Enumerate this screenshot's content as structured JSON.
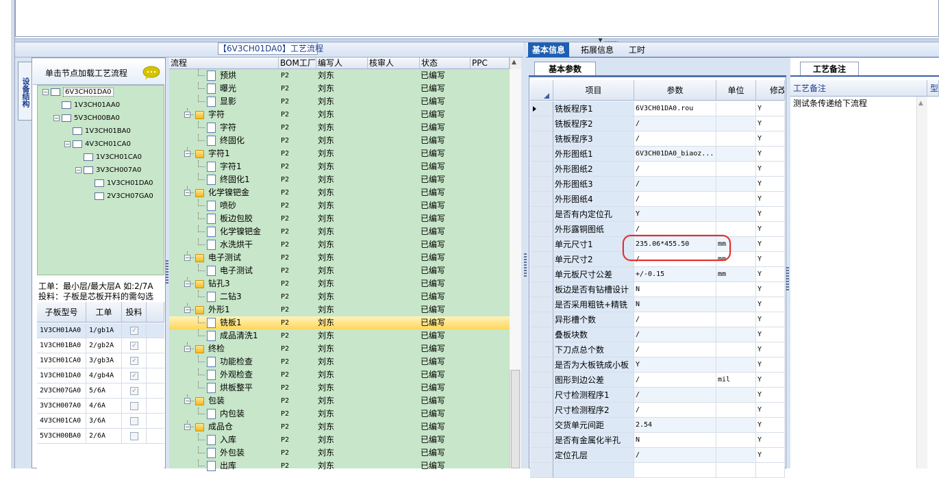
{
  "window": {
    "flow_title": "【6V3CH01DA0】工艺流程",
    "vertical_tab": "设备结构"
  },
  "tree_panel": {
    "load_hint": "单击节点加载工艺流程",
    "nodes": [
      {
        "label": "6V3CH01DA0",
        "selected": true
      },
      {
        "label": "1V3CH01AA0"
      },
      {
        "label": "5V3CH00BA0"
      },
      {
        "label": "1V3CH01BA0"
      },
      {
        "label": "4V3CH01CA0"
      },
      {
        "label": "1V3CH01CA0"
      },
      {
        "label": "3V3CH007A0"
      },
      {
        "label": "1V3CH01DA0"
      },
      {
        "label": "2V3CH07GA0"
      }
    ],
    "info_line1": "工单：最小层/最大层A 如:2/7A",
    "info_line2": "投料：子板是芯板开料的需勾选"
  },
  "board_grid": {
    "headers": [
      "子板型号",
      "工单",
      "投料"
    ],
    "rows": [
      {
        "model": "1V3CH01AA0",
        "order": "1/gb1A",
        "feed": true
      },
      {
        "model": "1V3CH01BA0",
        "order": "2/gb2A",
        "feed": true
      },
      {
        "model": "1V3CH01CA0",
        "order": "3/gb3A",
        "feed": true
      },
      {
        "model": "1V3CH01DA0",
        "order": "4/gb4A",
        "feed": true
      },
      {
        "model": "2V3CH07GA0",
        "order": "5/6A",
        "feed": true
      },
      {
        "model": "3V3CH007A0",
        "order": "4/6A",
        "feed": false
      },
      {
        "model": "4V3CH01CA0",
        "order": "3/6A",
        "feed": false
      },
      {
        "model": "5V3CH00BA0",
        "order": "2/6A",
        "feed": false
      }
    ]
  },
  "flow_grid": {
    "headers": [
      "流程",
      "BOM工厂",
      "编写人",
      "核审人",
      "状态",
      "PPC"
    ],
    "rows": [
      {
        "name": "预烘",
        "kind": "child",
        "bom": "P2",
        "writer": "刘东",
        "status": "已编写"
      },
      {
        "name": "曝光",
        "kind": "child",
        "bom": "P2",
        "writer": "刘东",
        "status": "已编写"
      },
      {
        "name": "显影",
        "kind": "child",
        "bom": "P2",
        "writer": "刘东",
        "status": "已编写"
      },
      {
        "name": "字符",
        "kind": "group",
        "bom": "P2",
        "writer": "刘东",
        "status": "已编写"
      },
      {
        "name": "字符",
        "kind": "child",
        "bom": "P2",
        "writer": "刘东",
        "status": "已编写"
      },
      {
        "name": "终固化",
        "kind": "child",
        "bom": "P2",
        "writer": "刘东",
        "status": "已编写"
      },
      {
        "name": "字符1",
        "kind": "group",
        "bom": "P2",
        "writer": "刘东",
        "status": "已编写"
      },
      {
        "name": "字符1",
        "kind": "child",
        "bom": "P2",
        "writer": "刘东",
        "status": "已编写"
      },
      {
        "name": "终固化1",
        "kind": "child",
        "bom": "P2",
        "writer": "刘东",
        "status": "已编写"
      },
      {
        "name": "化学镍钯金",
        "kind": "group",
        "bom": "P2",
        "writer": "刘东",
        "status": "已编写"
      },
      {
        "name": "喷砂",
        "kind": "child",
        "bom": "P2",
        "writer": "刘东",
        "status": "已编写"
      },
      {
        "name": "板边包胶",
        "kind": "child",
        "bom": "P2",
        "writer": "刘东",
        "status": "已编写"
      },
      {
        "name": "化学镍钯金",
        "kind": "child",
        "bom": "P2",
        "writer": "刘东",
        "status": "已编写"
      },
      {
        "name": "水洗烘干",
        "kind": "child",
        "bom": "P2",
        "writer": "刘东",
        "status": "已编写"
      },
      {
        "name": "电子测试",
        "kind": "group",
        "bom": "P2",
        "writer": "刘东",
        "status": "已编写"
      },
      {
        "name": "电子测试",
        "kind": "child",
        "bom": "P2",
        "writer": "刘东",
        "status": "已编写"
      },
      {
        "name": "钻孔3",
        "kind": "group",
        "bom": "P2",
        "writer": "刘东",
        "status": "已编写"
      },
      {
        "name": "二钻3",
        "kind": "child",
        "bom": "P2",
        "writer": "刘东",
        "status": "已编写"
      },
      {
        "name": "外形1",
        "kind": "group",
        "bom": "P2",
        "writer": "刘东",
        "status": "已编写"
      },
      {
        "name": "铣板1",
        "kind": "child",
        "bom": "P2",
        "writer": "刘东",
        "status": "已编写",
        "selected": true
      },
      {
        "name": "成品清洗1",
        "kind": "child",
        "bom": "P2",
        "writer": "刘东",
        "status": "已编写"
      },
      {
        "name": "终检",
        "kind": "group",
        "bom": "P2",
        "writer": "刘东",
        "status": "已编写"
      },
      {
        "name": "功能检查",
        "kind": "child",
        "bom": "P2",
        "writer": "刘东",
        "status": "已编写"
      },
      {
        "name": "外观检查",
        "kind": "child",
        "bom": "P2",
        "writer": "刘东",
        "status": "已编写"
      },
      {
        "name": "烘板整平",
        "kind": "child",
        "bom": "P2",
        "writer": "刘东",
        "status": "已编写"
      },
      {
        "name": "包装",
        "kind": "group",
        "bom": "P2",
        "writer": "刘东",
        "status": "已编写"
      },
      {
        "name": "内包装",
        "kind": "child",
        "bom": "P2",
        "writer": "刘东",
        "status": "已编写"
      },
      {
        "name": "成品仓",
        "kind": "group",
        "bom": "P2",
        "writer": "刘东",
        "status": "已编写"
      },
      {
        "name": "入库",
        "kind": "child",
        "bom": "P2",
        "writer": "刘东",
        "status": "已编写"
      },
      {
        "name": "外包装",
        "kind": "child",
        "bom": "P2",
        "writer": "刘东",
        "status": "已编写"
      },
      {
        "name": "出库",
        "kind": "child",
        "bom": "P2",
        "writer": "刘东",
        "status": "已编写"
      }
    ]
  },
  "right_tabs": [
    "基本信息",
    "拓展信息",
    "工时"
  ],
  "param_panel": {
    "subtab": "基本参数",
    "headers": [
      "项目",
      "参数",
      "单位",
      "修改"
    ],
    "rows": [
      {
        "item": "铣板程序1",
        "param": "6V3CH01DA0.rou",
        "unit": "",
        "mod": "Y",
        "current": true
      },
      {
        "item": "铣板程序2",
        "param": "/",
        "unit": "",
        "mod": "Y"
      },
      {
        "item": "铣板程序3",
        "param": "/",
        "unit": "",
        "mod": "Y"
      },
      {
        "item": "外形图纸1",
        "param": "6V3CH01DA0_biaoz...",
        "unit": "",
        "mod": "Y"
      },
      {
        "item": "外形图纸2",
        "param": "/",
        "unit": "",
        "mod": "Y"
      },
      {
        "item": "外形图纸3",
        "param": "/",
        "unit": "",
        "mod": "Y"
      },
      {
        "item": "外形图纸4",
        "param": "/",
        "unit": "",
        "mod": "Y"
      },
      {
        "item": "是否有内定位孔",
        "param": "Y",
        "unit": "",
        "mod": "Y"
      },
      {
        "item": "外形露铜图纸",
        "param": "/",
        "unit": "",
        "mod": "Y"
      },
      {
        "item": "单元尺寸1",
        "param": "235.06*455.50",
        "unit": "mm",
        "mod": "Y"
      },
      {
        "item": "单元尺寸2",
        "param": "/",
        "unit": "mm",
        "mod": "Y"
      },
      {
        "item": "单元板尺寸公差",
        "param": "+/-0.15",
        "unit": "mm",
        "mod": "Y"
      },
      {
        "item": "板边是否有钻槽设计",
        "param": "N",
        "unit": "",
        "mod": "Y"
      },
      {
        "item": "是否采用粗铣+精铣",
        "param": "N",
        "unit": "",
        "mod": "Y"
      },
      {
        "item": "异形槽个数",
        "param": "/",
        "unit": "",
        "mod": "Y"
      },
      {
        "item": "叠板块数",
        "param": "/",
        "unit": "",
        "mod": "Y"
      },
      {
        "item": "下刀点总个数",
        "param": "/",
        "unit": "",
        "mod": "Y"
      },
      {
        "item": "是否为大板铣成小板",
        "param": "Y",
        "unit": "",
        "mod": "Y"
      },
      {
        "item": "图形到边公差",
        "param": "/",
        "unit": "mil",
        "mod": "Y"
      },
      {
        "item": "尺寸检测程序1",
        "param": "/",
        "unit": "",
        "mod": "Y"
      },
      {
        "item": "尺寸检测程序2",
        "param": "/",
        "unit": "",
        "mod": "Y"
      },
      {
        "item": "交货单元间距",
        "param": "2.54",
        "unit": "",
        "mod": "Y"
      },
      {
        "item": "是否有金属化半孔",
        "param": "N",
        "unit": "",
        "mod": "Y"
      },
      {
        "item": "定位孔层",
        "param": "/",
        "unit": "",
        "mod": "Y"
      },
      {
        "item": "",
        "param": "",
        "unit": "",
        "mod": ""
      }
    ]
  },
  "notes_panel": {
    "tab": "工艺备注",
    "headers": [
      "工艺备注",
      "型号"
    ],
    "text": "测试条传递给下流程"
  },
  "colors": {
    "accent": "#1f5fb2",
    "tree_bg": "#c8e6c9",
    "selected_row": "#ffd65c",
    "highlight_ring": "#e03030"
  }
}
